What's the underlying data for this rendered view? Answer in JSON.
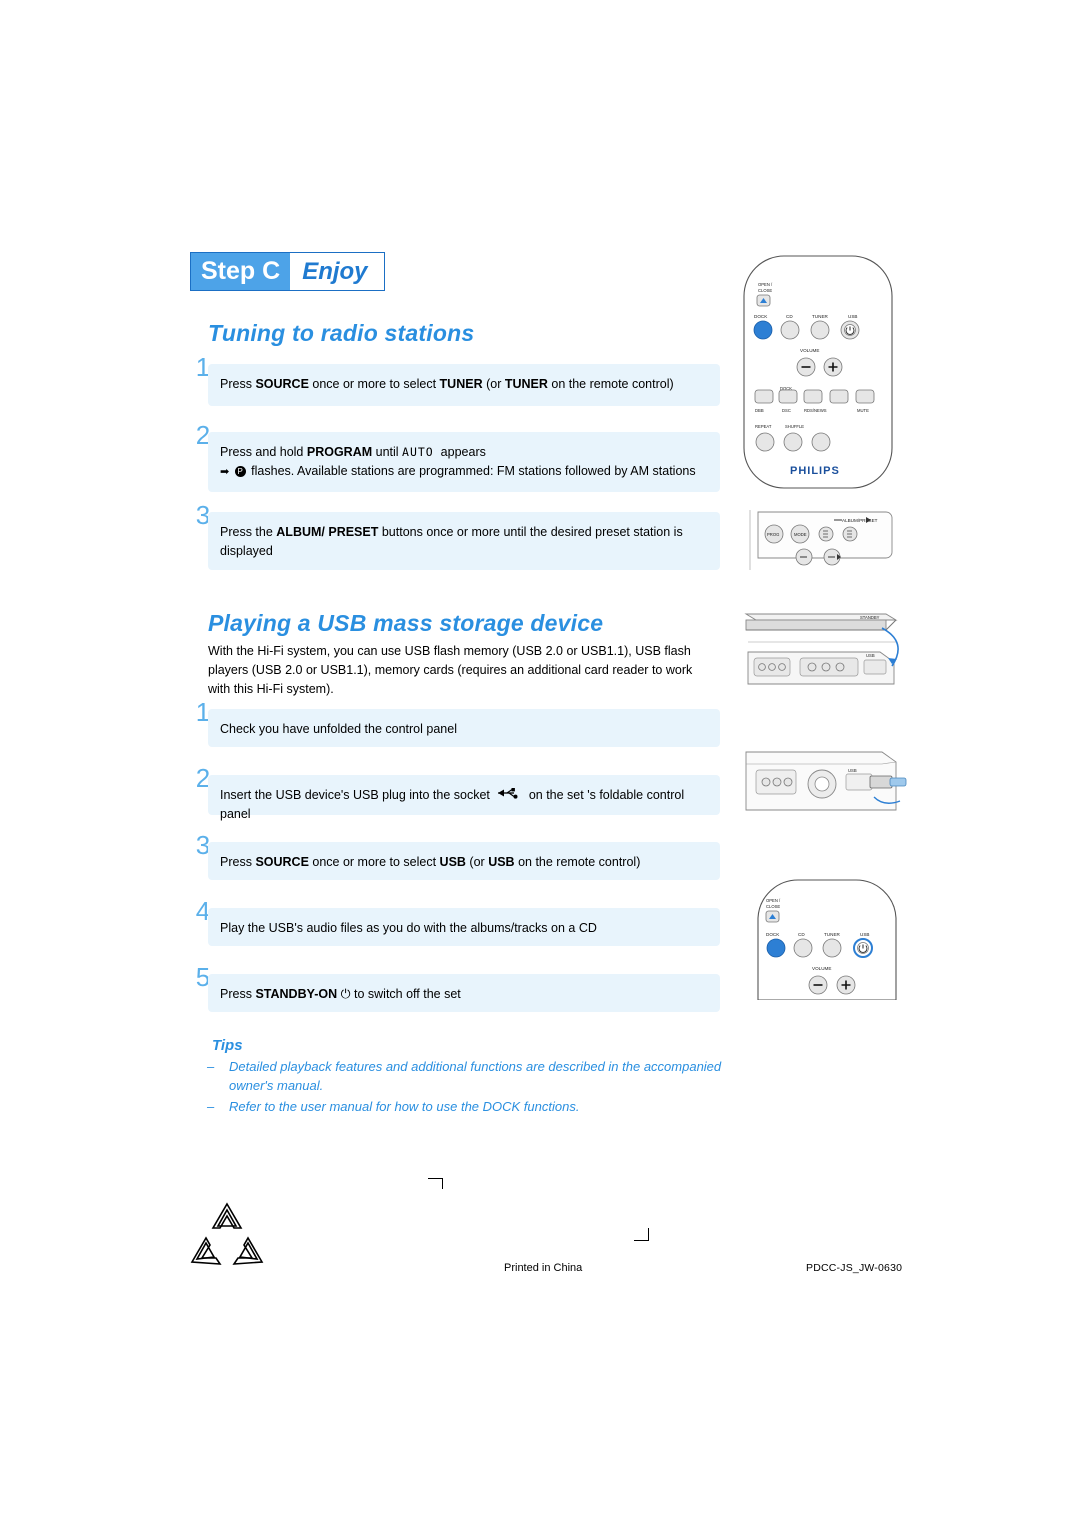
{
  "header": {
    "step_box": "Step C",
    "step_label": "Enjoy"
  },
  "sections": [
    {
      "id": "tuning",
      "title": "Tuning to radio stations"
    },
    {
      "id": "usb",
      "title": "Playing a USB mass storage device"
    }
  ],
  "tuning_steps": [
    {
      "num": "1",
      "text_html": "Press <b>SOURCE</b> once or more to select <b>TUNER</b> (or <b>TUNER</b> on the remote control)"
    },
    {
      "num": "2",
      "text_html": "Press and hold <b>PROGRAM</b> until <span class=\"lcd\">AUTO</span>&nbsp; appears<br><span class=\"arrow-glyph\">➡</span> <span class=\"circ-icon\">P</span> flashes. Available stations are programmed: FM stations followed by AM stations"
    },
    {
      "num": "3",
      "text_html": "Press the <b>ALBUM/ PRESET</b> buttons once or more until the desired preset station is displayed"
    }
  ],
  "usb_intro": "With the Hi-Fi system, you can use USB flash memory (USB 2.0 or USB1.1), USB flash players (USB 2.0 or USB1.1), memory cards (requires an additional card reader  to work with this Hi-Fi system).",
  "usb_steps": [
    {
      "num": "1",
      "text_html": "Check you have unfolded the control panel"
    },
    {
      "num": "2",
      "text_html": "Insert the USB device's USB plug into the socket <span class=\"usb-inline\" data-name=\"usb-symbol-icon\"></span> on the set 's foldable control panel"
    },
    {
      "num": "3",
      "text_html": "Press <b>SOURCE</b> once or more to select <b>USB</b> (or <b>USB</b> on the remote control)"
    },
    {
      "num": "4",
      "text_html": "Play the USB's audio files as you do with the albums/tracks on a CD"
    },
    {
      "num": "5",
      "text_html": "Press <b>STANDBY-ON</b> &#9211; to switch off the set"
    }
  ],
  "tips": {
    "title": "Tips",
    "items": [
      "Detailed playback features and additional functions are described in the accompanied owner's manual.",
      "Refer to the user manual for how to use the DOCK functions."
    ]
  },
  "footer": {
    "printed": "Printed in China",
    "code": "PDCC-JS_JW-0630"
  },
  "remote": {
    "brand": "PHILIPS",
    "labels": {
      "open_close_1": "OPEN /",
      "open_close_2": "CLOSE",
      "dock": "DOCK",
      "cd": "CD",
      "tuner": "TUNER",
      "usb": "USB",
      "volume": "VOLUME",
      "dbb": "DBB",
      "dsc": "DSC",
      "rds_news": "RDS/NEWS",
      "mute": "MUTE",
      "repeat": "REPEAT",
      "shuffle": "SHUFFLE",
      "dock_small": "DOCK"
    }
  },
  "panel": {
    "album_preset": "ALBUM/PRESET",
    "prog": "PROG",
    "mode": "MODE",
    "usb_label": "USB",
    "standby": "STANDBY"
  },
  "colors": {
    "accent_blue": "#2a8fe0",
    "step_box_blue": "#4da3e8",
    "panel_bg": "#e8f4fc",
    "number_blue": "#5bb0ea"
  }
}
